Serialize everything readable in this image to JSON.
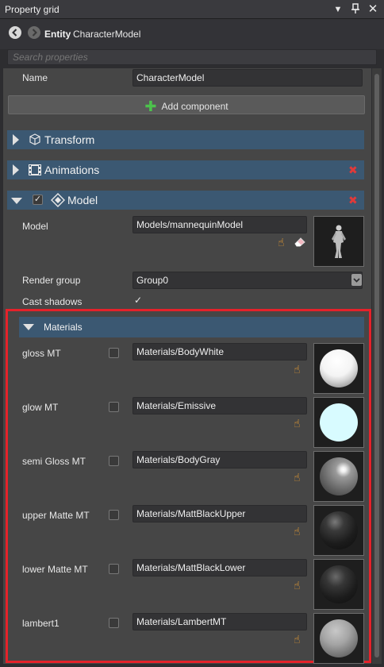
{
  "window": {
    "title": "Property grid",
    "title_icons": [
      "dropdown-icon",
      "pin-icon",
      "close-icon"
    ]
  },
  "entity": {
    "kind": "Entity",
    "name": "CharacterModel"
  },
  "search": {
    "placeholder": "Search properties"
  },
  "name_field": {
    "label": "Name",
    "value": "CharacterModel"
  },
  "add_component_label": "Add component",
  "components": {
    "transform": "Transform",
    "animations": "Animations",
    "model": "Model"
  },
  "model": {
    "model_label": "Model",
    "model_value": "Models/mannequinModel",
    "render_group_label": "Render group",
    "render_group_value": "Group0",
    "cast_shadows_label": "Cast shadows",
    "cast_shadows_checked": true
  },
  "materials": {
    "header": "Materials",
    "items": [
      {
        "name": "gloss MT",
        "value": "Materials/BodyWhite",
        "preview": "white-sphere"
      },
      {
        "name": "glow MT",
        "value": "Materials/Emissive",
        "preview": "emissive-disc"
      },
      {
        "name": "semi Gloss MT",
        "value": "Materials/BodyGray",
        "preview": "gray-sphere"
      },
      {
        "name": "upper Matte MT",
        "value": "Materials/MattBlackUpper",
        "preview": "black-sphere"
      },
      {
        "name": "lower Matte MT",
        "value": "Materials/MattBlackLower",
        "preview": "black-sphere"
      },
      {
        "name": "lambert1",
        "value": "Materials/LambertMT",
        "preview": "lambert-sphere"
      }
    ]
  },
  "colors": {
    "section_header": "#3b5872",
    "highlight": "#e5222a",
    "add_icon": "#4cc24c",
    "delete_icon": "#e03a3a"
  }
}
